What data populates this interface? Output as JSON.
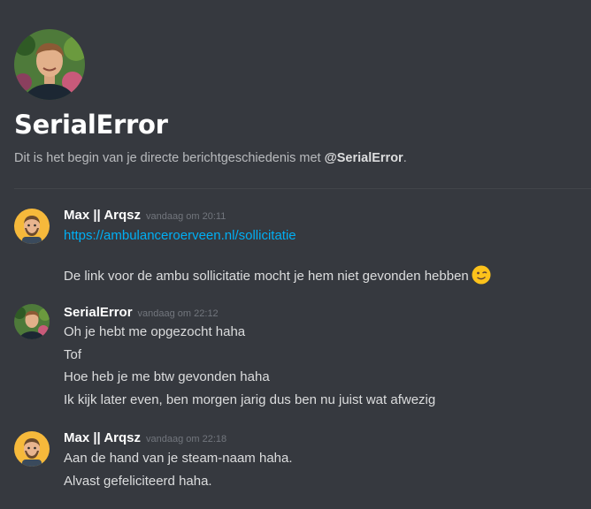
{
  "channel": {
    "title": "SerialError",
    "intro_prefix": "Dit is het begin van je directe berichtgeschiedenis met ",
    "intro_user": "@SerialError",
    "intro_suffix": "."
  },
  "messages": [
    {
      "author": "Max || Arqsz",
      "timestamp": "vandaag om 20:11",
      "avatar_icon": "cartoon-man-avatar-icon",
      "lines": [
        "https://ambulanceroerveen.nl/sollicitatie",
        "De link voor de ambu sollicitatie mocht je hem niet gevonden hebben"
      ],
      "emoji": "winking-face-emoji"
    },
    {
      "author": "SerialError",
      "timestamp": "vandaag om 22:12",
      "avatar_icon": "photo-avatar-icon",
      "lines": [
        "Oh je hebt me opgezocht haha",
        "Tof",
        "Hoe heb je me btw gevonden haha",
        "Ik kijk later even, ben morgen jarig dus ben nu juist wat afwezig"
      ]
    },
    {
      "author": "Max || Arqsz",
      "timestamp": "vandaag om 22:18",
      "avatar_icon": "cartoon-man-avatar-icon",
      "lines": [
        "Aan de hand van je steam-naam haha.",
        "Alvast gefeliciteerd haha."
      ]
    }
  ],
  "colors": {
    "background": "#36393f",
    "link": "#00aff4",
    "timestamp": "#72767d"
  }
}
